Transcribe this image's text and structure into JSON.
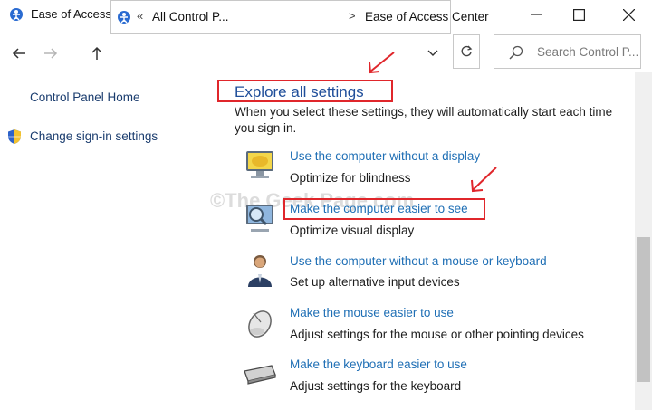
{
  "window": {
    "title": "Ease of Access Center"
  },
  "address_bar": {
    "chevron": "«",
    "crumbs": [
      "All Control P...",
      "Ease of Access Center"
    ],
    "separator": ">"
  },
  "search": {
    "placeholder": "Search Control P..."
  },
  "sidebar": {
    "home": "Control Panel Home",
    "change_signin": "Change sign-in settings"
  },
  "main": {
    "heading": "Explore all settings",
    "intro": "When you select these settings, they will automatically start each time you sign in.",
    "items": [
      {
        "link": "Use the computer without a display",
        "desc": "Optimize for blindness",
        "icon": "display-narrator-icon"
      },
      {
        "link": "Make the computer easier to see",
        "desc": "Optimize visual display",
        "icon": "magnifier-monitor-icon"
      },
      {
        "link": "Use the computer without a mouse or keyboard",
        "desc": "Set up alternative input devices",
        "icon": "person-icon"
      },
      {
        "link": "Make the mouse easier to use",
        "desc": "Adjust settings for the mouse or other pointing devices",
        "icon": "mouse-icon"
      },
      {
        "link": "Make the keyboard easier to use",
        "desc": "Adjust settings for the keyboard",
        "icon": "keyboard-icon"
      }
    ]
  },
  "watermark": "©The Geek Page.com",
  "colors": {
    "link": "#1f6fb5",
    "heading": "#1f4e9a",
    "annotation": "#e0262b"
  }
}
